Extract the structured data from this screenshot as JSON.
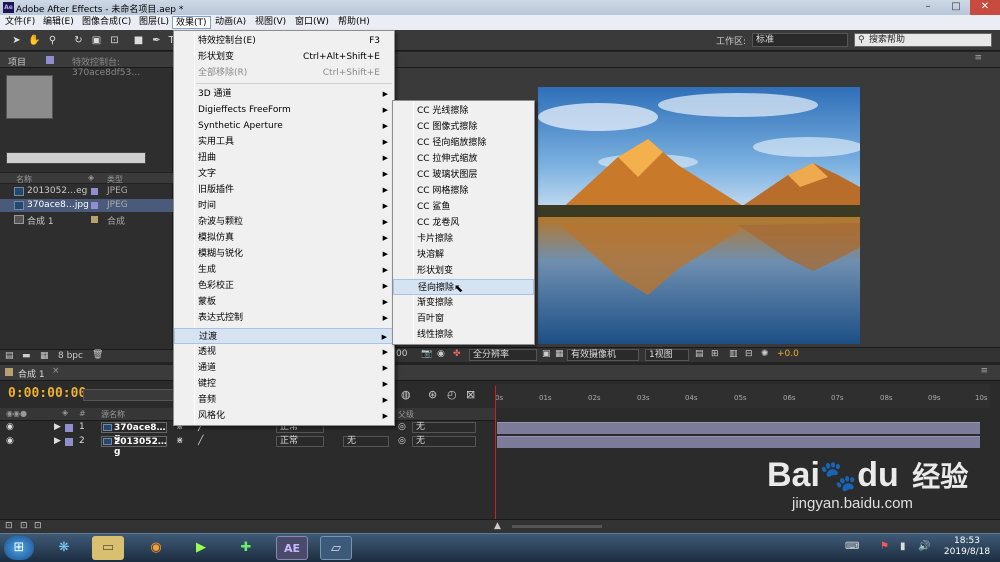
{
  "title_bar": {
    "title": "Adobe After Effects - 未命名项目.aep *",
    "app_icon": "Ae",
    "minimize": "–",
    "maximize": "□",
    "close": "✕"
  },
  "menubar": [
    {
      "label": "文件(F)"
    },
    {
      "label": "编辑(E)"
    },
    {
      "label": "图像合成(C)"
    },
    {
      "label": "图层(L)"
    },
    {
      "label": "效果(T)"
    },
    {
      "label": "动画(A)"
    },
    {
      "label": "视图(V)"
    },
    {
      "label": "窗口(W)"
    },
    {
      "label": "帮助(H)"
    }
  ],
  "toolbar": {
    "workspace_label": "工作区:",
    "workspace_value": "标准",
    "help_search": "搜索帮助"
  },
  "project_panel": {
    "tab_project": "项目",
    "tab_effects": "特效控制台: 370ace8df53…",
    "header": {
      "name": "名称",
      "type": "类型"
    },
    "items": [
      {
        "name": "2013052…eg",
        "type": "JPEG",
        "color": "#8f8fd0"
      },
      {
        "name": "370ace8…jpg",
        "type": "JPEG",
        "color": "#8f8fd0"
      },
      {
        "name": "合成 1",
        "type": "合成",
        "color": "#b8a070"
      }
    ],
    "bpc": "8 bpc"
  },
  "viewer": {
    "time": "00",
    "resolution": "全分辨率",
    "camera": "有效摄像机",
    "views": "1视图",
    "exposure": "+0.0"
  },
  "effects_menu": {
    "items": [
      {
        "label": "特效控制台(E)",
        "shortcut": "F3"
      },
      {
        "label": "形状划变",
        "shortcut": "Ctrl+Alt+Shift+E"
      },
      {
        "label": "全部移除(R)",
        "shortcut": "Ctrl+Shift+E"
      },
      {
        "label": "3D 通道"
      },
      {
        "label": "Digieffects FreeForm"
      },
      {
        "label": "Synthetic Aperture"
      },
      {
        "label": "实用工具"
      },
      {
        "label": "扭曲"
      },
      {
        "label": "文字"
      },
      {
        "label": "旧版插件"
      },
      {
        "label": "时间"
      },
      {
        "label": "杂波与颗粒"
      },
      {
        "label": "模拟仿真"
      },
      {
        "label": "模糊与锐化"
      },
      {
        "label": "生成"
      },
      {
        "label": "色彩校正"
      },
      {
        "label": "蒙板"
      },
      {
        "label": "表达式控制"
      },
      {
        "label": "过渡"
      },
      {
        "label": "透视"
      },
      {
        "label": "通道"
      },
      {
        "label": "键控"
      },
      {
        "label": "音频"
      },
      {
        "label": "风格化"
      }
    ]
  },
  "transition_submenu": {
    "items": [
      {
        "label": "CC 光线擦除"
      },
      {
        "label": "CC 图像式擦除"
      },
      {
        "label": "CC 径向缩放擦除"
      },
      {
        "label": "CC 拉伸式缩放"
      },
      {
        "label": "CC 玻璃状图层"
      },
      {
        "label": "CC 网格擦除"
      },
      {
        "label": "CC 鲨鱼"
      },
      {
        "label": "CC 龙卷风"
      },
      {
        "label": "卡片擦除"
      },
      {
        "label": "块溶解"
      },
      {
        "label": "形状划变"
      },
      {
        "label": "径向擦除"
      },
      {
        "label": "渐变擦除"
      },
      {
        "label": "百叶窗"
      },
      {
        "label": "线性擦除"
      }
    ]
  },
  "timeline": {
    "tab": "合成 1",
    "timecode": "0:00:00:00",
    "header": {
      "num": "#",
      "source": "源名称",
      "parent": "父级"
    },
    "ticks": [
      "0s",
      "01s",
      "02s",
      "03s",
      "04s",
      "05s",
      "06s",
      "07s",
      "08s",
      "09s",
      "10s"
    ],
    "layers": [
      {
        "num": "1",
        "name": "370ace8…g",
        "mode": "正常",
        "parent": "无"
      },
      {
        "num": "2",
        "name": "2013052…g",
        "mode": "正常",
        "trkmat": "无",
        "parent": "无"
      }
    ]
  },
  "taskbar": {
    "time": "18:53",
    "date": "2019/8/18",
    "apps": [
      "start-orb",
      "media-icon",
      "explorer-icon",
      "firefox-icon",
      "video-editor-icon",
      "360-icon",
      "after-effects-icon",
      "notepad-icon"
    ]
  },
  "watermark": {
    "brand": "Bai",
    "brand_mid": "du",
    "cn": "经验",
    "url": "jingyan.baidu.com"
  }
}
